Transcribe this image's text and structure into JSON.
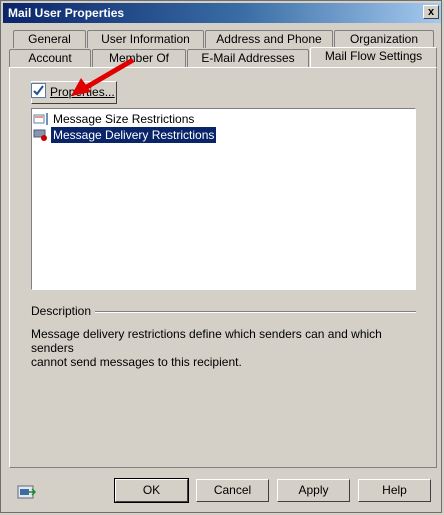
{
  "window": {
    "title": "Mail User Properties",
    "close_glyph": "x"
  },
  "tabs": {
    "row1": [
      "General",
      "User Information",
      "Address and Phone",
      "Organization"
    ],
    "row2": [
      "Account",
      "Member Of",
      "E-Mail Addresses",
      "Mail Flow Settings"
    ],
    "active": "Mail Flow Settings"
  },
  "toolbar": {
    "properties_label": "Properties..."
  },
  "list": {
    "items": [
      {
        "label": "Message Size Restrictions",
        "icon": "message-size-icon",
        "selected": false
      },
      {
        "label": "Message Delivery Restrictions",
        "icon": "message-delivery-icon",
        "selected": true
      }
    ]
  },
  "description": {
    "label": "Description",
    "text_line1": "Message delivery restrictions define which senders can and which senders",
    "text_line2": "cannot send messages to this recipient."
  },
  "footer": {
    "ok_label": "OK",
    "cancel_label": "Cancel",
    "apply_label": "Apply",
    "help_label": "Help",
    "help_icon": "exchange-console-icon"
  },
  "colors": {
    "titlebar_start": "#0a246a",
    "selection": "#0a246a",
    "arrow": "#e00000"
  }
}
